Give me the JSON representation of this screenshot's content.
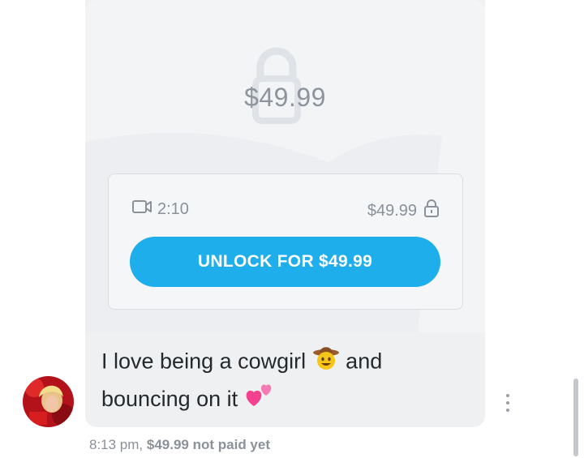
{
  "locked_media": {
    "price_overlay": "$49.99",
    "duration": "2:10",
    "price": "$49.99",
    "unlock_label": "UNLOCK FOR $49.99",
    "icons": [
      "video-camera-icon",
      "lock-icon",
      "large-lock-icon"
    ],
    "accent_color": "#1eaeeb"
  },
  "message": {
    "line1": "I love being a cowgirl",
    "line1_end": "and",
    "line2": "bouncing on it",
    "emojis": [
      "cowboy-face-emoji",
      "two-hearts-emoji"
    ]
  },
  "meta": {
    "time": "8:13 pm,",
    "status": "$49.99 not paid yet"
  }
}
